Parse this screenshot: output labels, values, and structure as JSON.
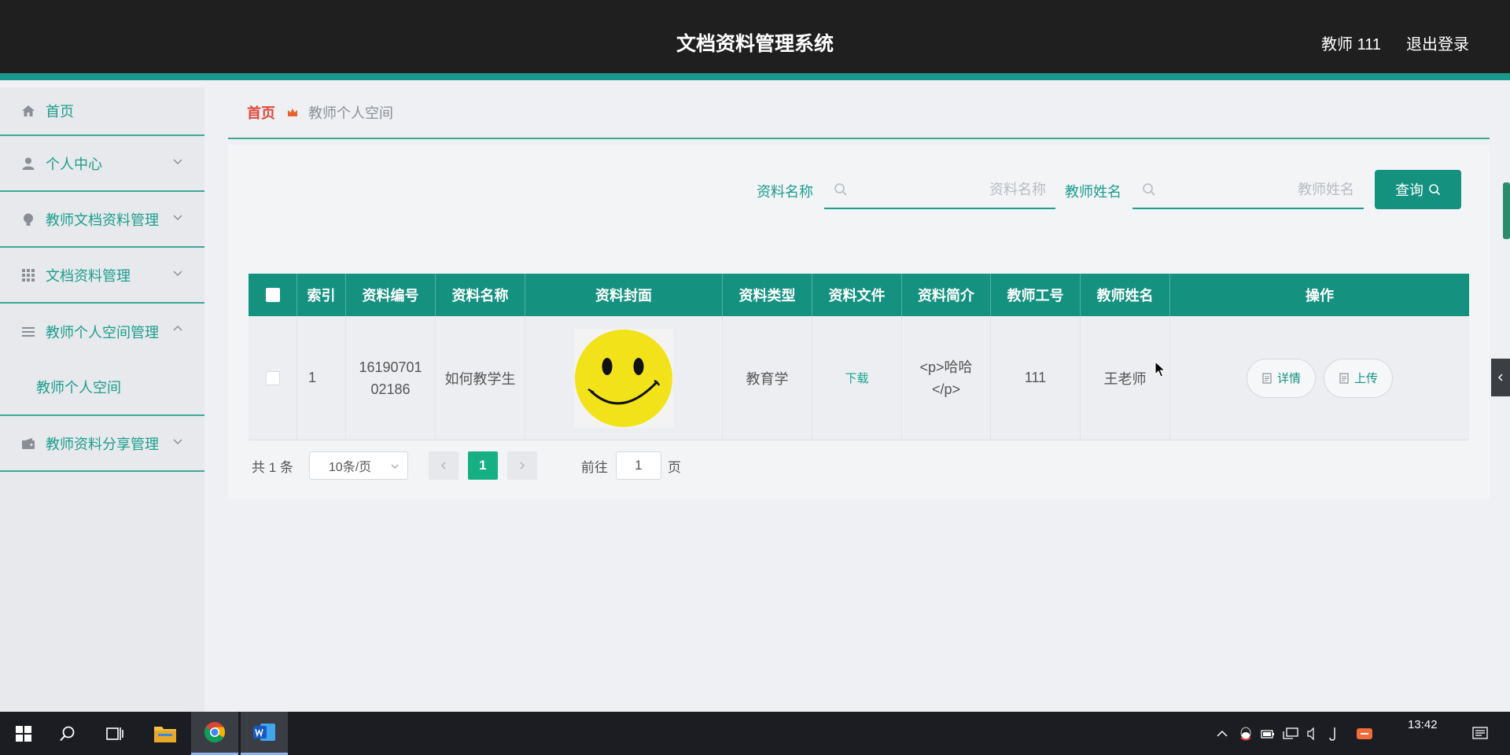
{
  "header": {
    "title": "文档资料管理系统",
    "user": "教师 111",
    "logout": "退出登录"
  },
  "sidebar": {
    "items": [
      {
        "label": "首页",
        "icon": "home-icon",
        "expandable": false
      },
      {
        "label": "个人中心",
        "icon": "user-icon",
        "expandable": true,
        "expanded": false
      },
      {
        "label": "教师文档资料管理",
        "icon": "bulb-icon",
        "expandable": true,
        "expanded": false
      },
      {
        "label": "文档资料管理",
        "icon": "grid-icon",
        "expandable": true,
        "expanded": false
      },
      {
        "label": "教师个人空间管理",
        "icon": "list-icon",
        "expandable": true,
        "expanded": true,
        "children": [
          "教师个人空间"
        ]
      },
      {
        "label": "教师资料分享管理",
        "icon": "wallet-icon",
        "expandable": true,
        "expanded": false
      }
    ]
  },
  "breadcrumb": {
    "home": "首页",
    "current": "教师个人空间"
  },
  "search": {
    "name_label": "资料名称",
    "name_placeholder": "资料名称",
    "teacher_label": "教师姓名",
    "teacher_placeholder": "教师姓名",
    "query_label": "查询"
  },
  "table": {
    "columns": [
      "索引",
      "资料编号",
      "资料名称",
      "资料封面",
      "资料类型",
      "资料文件",
      "资料简介",
      "教师工号",
      "教师姓名",
      "操作"
    ],
    "rows": [
      {
        "index": "1",
        "code_line1": "16190701",
        "code_line2": "02186",
        "name": "如何教学生",
        "cover": "smiley-face-image",
        "type": "教育学",
        "file": "下载",
        "intro_line1": "<p>哈哈",
        "intro_line2": "</p>",
        "teacher_id": "111",
        "teacher_name": "王老师",
        "actions": [
          "详情",
          "上传"
        ]
      }
    ]
  },
  "pagination": {
    "total": "共 1 条",
    "page_size": "10条/页",
    "current_page": "1",
    "goto_label": "前往",
    "goto_value": "1",
    "goto_unit": "页"
  },
  "taskbar": {
    "apps": [
      "windows-start-icon",
      "search-icon",
      "task-view-icon",
      "file-explorer-icon",
      "chrome-icon",
      "word-icon"
    ],
    "clock": "13:42"
  },
  "colors": {
    "accent": "#14917f",
    "header_bg": "#1f1f20",
    "breadcrumb_home": "#e0473a"
  }
}
